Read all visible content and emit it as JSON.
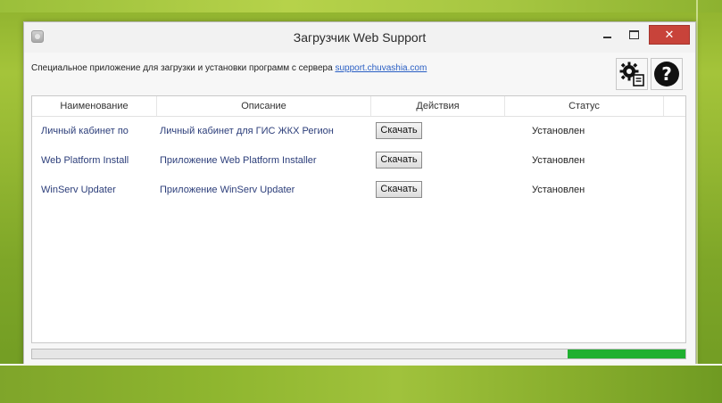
{
  "window": {
    "title": "Загрузчик Web Support"
  },
  "description": {
    "text": "Специальное приложение для загрузки и установки программ с сервера ",
    "link": "support.chuvashia.com"
  },
  "toolbar": {
    "settings_icon": "gear-settings-icon",
    "help_icon": "help-icon",
    "help_glyph": "?"
  },
  "columns": [
    "Наименование",
    "Описание",
    "Действия",
    "Статус"
  ],
  "rows": [
    {
      "name": "Личный кабинет по",
      "description": "Личный кабинет для ГИС ЖКХ Регион",
      "action": "Скачать",
      "status": "Установлен"
    },
    {
      "name": "Web Platform Install",
      "description": "Приложение Web Platform Installer",
      "action": "Скачать",
      "status": "Установлен"
    },
    {
      "name": "WinServ Updater",
      "description": "Приложение WinServ Updater",
      "action": "Скачать",
      "status": "Установлен"
    }
  ],
  "progress": {
    "fill_fraction": 0.18,
    "fill_color": "#1fb030",
    "fill_from": "right"
  },
  "colors": {
    "close_button": "#c8433a",
    "link": "#2a5fc4",
    "row_text": "#2c3e7a"
  }
}
